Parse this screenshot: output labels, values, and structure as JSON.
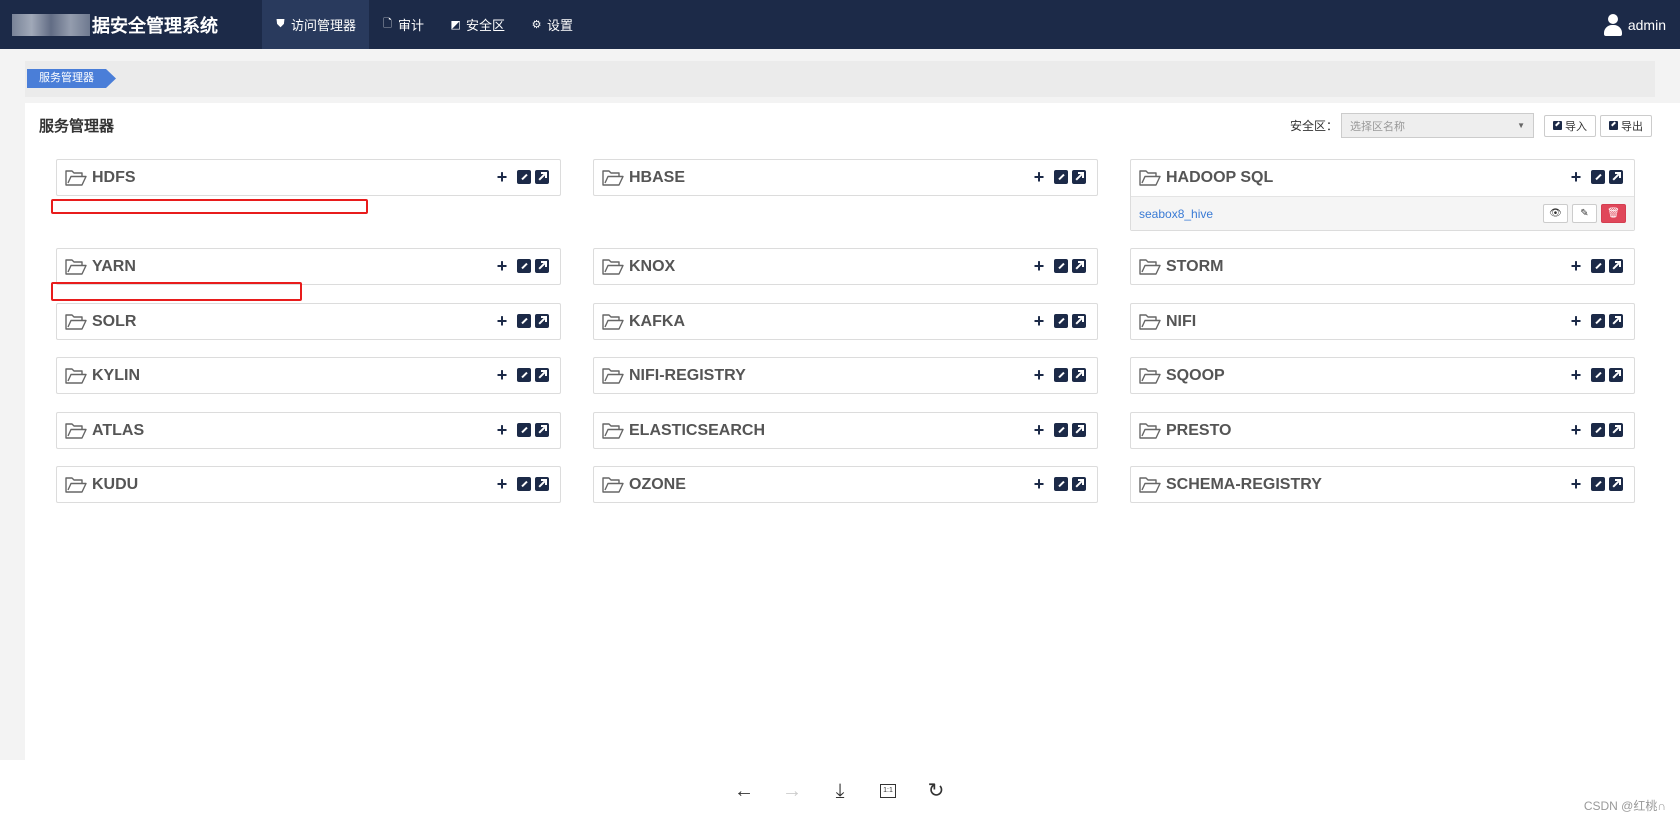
{
  "app": {
    "title": "据安全管理系统",
    "user": "admin"
  },
  "nav": {
    "items": [
      {
        "label": "访问管理器",
        "icon": "shield-icon",
        "glyph": "⛊"
      },
      {
        "label": "审计",
        "icon": "file-icon",
        "glyph": "🗋"
      },
      {
        "label": "安全区",
        "icon": "zone-icon",
        "glyph": "◩"
      },
      {
        "label": "设置",
        "icon": "gear-icon",
        "glyph": "⚙"
      }
    ]
  },
  "breadcrumb": {
    "label": "服务管理器"
  },
  "main": {
    "title": "服务管理器",
    "zone_label": "安全区：",
    "zone_placeholder": "选择区名称",
    "import_label": "导入",
    "export_label": "导出"
  },
  "services": [
    {
      "name": "HDFS"
    },
    {
      "name": "HBASE"
    },
    {
      "name": "HADOOP SQL",
      "items": [
        {
          "label": "seabox8_hive"
        }
      ]
    },
    {
      "name": "YARN"
    },
    {
      "name": "KNOX"
    },
    {
      "name": "STORM"
    },
    {
      "name": "SOLR"
    },
    {
      "name": "KAFKA"
    },
    {
      "name": "NIFI"
    },
    {
      "name": "KYLIN"
    },
    {
      "name": "NIFI-REGISTRY"
    },
    {
      "name": "SQOOP"
    },
    {
      "name": "ATLAS"
    },
    {
      "name": "ELASTICSEARCH"
    },
    {
      "name": "PRESTO"
    },
    {
      "name": "KUDU"
    },
    {
      "name": "OZONE"
    },
    {
      "name": "SCHEMA-REGISTRY"
    }
  ],
  "viewer": {
    "fit_label": "1:1",
    "watermark": "CSDN @红桃∩"
  },
  "colors": {
    "navbar": "#1c2a48",
    "breadcrumb": "#4a7ed8",
    "link": "#3a7bd5",
    "danger": "#e0475a",
    "annotation": "#e81c1c"
  }
}
